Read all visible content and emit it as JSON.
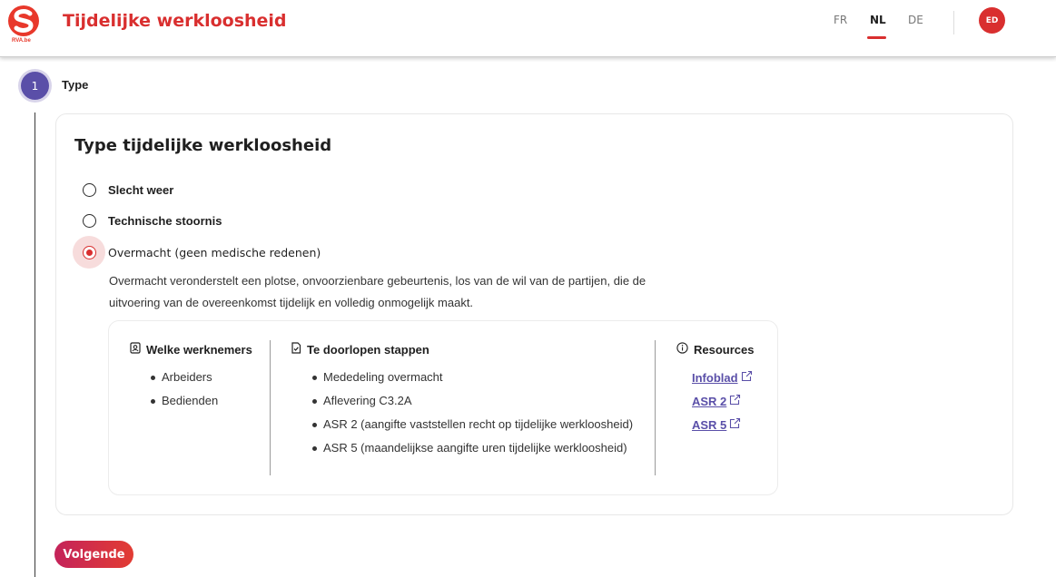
{
  "header": {
    "logo_text": "RVA.be",
    "title": "Tijdelijke werkloosheid",
    "languages": [
      "FR",
      "NL",
      "DE"
    ],
    "active_language": "NL",
    "avatar_initials": "ED"
  },
  "stepper": {
    "step_number": "1",
    "step_label": "Type"
  },
  "card": {
    "title": "Type tijdelijke werkloosheid",
    "options": [
      {
        "label": "Slecht weer",
        "selected": false
      },
      {
        "label": "Technische stoornis",
        "selected": false
      },
      {
        "label": "Overmacht (geen medische redenen)",
        "selected": true
      }
    ],
    "description_line1": "Overmacht veronderstelt een plotse, onvoorzienbare gebeurtenis, los van de wil van de partijen, die de",
    "description_line2": "uitvoering van de overeenkomst tijdelijk en volledig onmogelijk maakt.",
    "info": {
      "employees_heading": "Welke werknemers",
      "employees": [
        "Arbeiders",
        "Bedienden"
      ],
      "steps_heading": "Te doorlopen stappen",
      "steps": [
        "Mededeling overmacht",
        "Aflevering C3.2A",
        "ASR 2 (aangifte vaststellen recht op tijdelijke werkloosheid)",
        "ASR 5 (maandelijkse aangifte uren tijdelijke werkloosheid)"
      ],
      "resources_heading": "Resources",
      "resources": [
        "Infoblad",
        "ASR 2",
        "ASR 5"
      ]
    }
  },
  "actions": {
    "next_label": "Volgende"
  },
  "colors": {
    "brand_red": "#d92f2f",
    "accent_purple": "#5a4fa8"
  }
}
